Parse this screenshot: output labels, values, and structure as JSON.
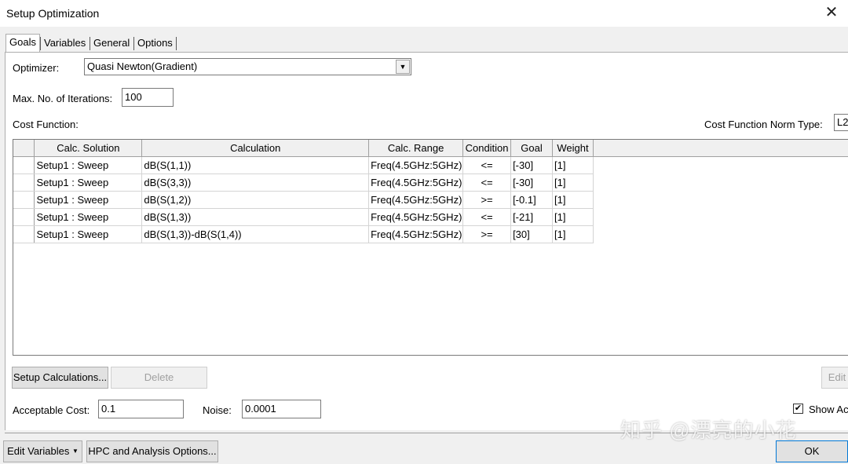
{
  "window": {
    "title": "Setup Optimization",
    "close_glyph": "✕"
  },
  "tabs": [
    "Goals",
    "Variables",
    "General",
    "Options"
  ],
  "optimizer": {
    "label": "Optimizer:",
    "value": "Quasi Newton(Gradient)"
  },
  "iterations": {
    "label": "Max. No. of Iterations:",
    "value": "100"
  },
  "cost_function": {
    "label": "Cost Function:",
    "norm_label": "Cost Function Norm Type:",
    "norm_value": "L2"
  },
  "table": {
    "headers": [
      "Calc. Solution",
      "Calculation",
      "Calc. Range",
      "Condition",
      "Goal",
      "Weight"
    ],
    "rows": [
      [
        "Setup1 : Sweep",
        "dB(S(1,1))",
        "Freq(4.5GHz:5GHz)",
        "<=",
        "[-30]",
        "[1]"
      ],
      [
        "Setup1 : Sweep",
        "dB(S(3,3))",
        "Freq(4.5GHz:5GHz)",
        "<=",
        "[-30]",
        "[1]"
      ],
      [
        "Setup1 : Sweep",
        "dB(S(1,2))",
        "Freq(4.5GHz:5GHz)",
        ">=",
        "[-0.1]",
        "[1]"
      ],
      [
        "Setup1 : Sweep",
        "dB(S(1,3))",
        "Freq(4.5GHz:5GHz)",
        "<=",
        "[-21]",
        "[1]"
      ],
      [
        "Setup1 : Sweep",
        "dB(S(1,3))-dB(S(1,4))",
        "Freq(4.5GHz:5GHz)",
        ">=",
        "[30]",
        "[1]"
      ]
    ]
  },
  "buttons": {
    "setup_calculations": "Setup Calculations...",
    "delete": "Delete",
    "edit": "Edit",
    "edit_variables": "Edit Variables",
    "hpc": "HPC and Analysis Options...",
    "ok": "OK"
  },
  "acceptable_cost": {
    "label": "Acceptable Cost:",
    "value": "0.1"
  },
  "noise": {
    "label": "Noise:",
    "value": "0.0001"
  },
  "show_all": {
    "label": "Show Ac",
    "checked": true
  },
  "watermark": "知乎 @漂亮的小花"
}
